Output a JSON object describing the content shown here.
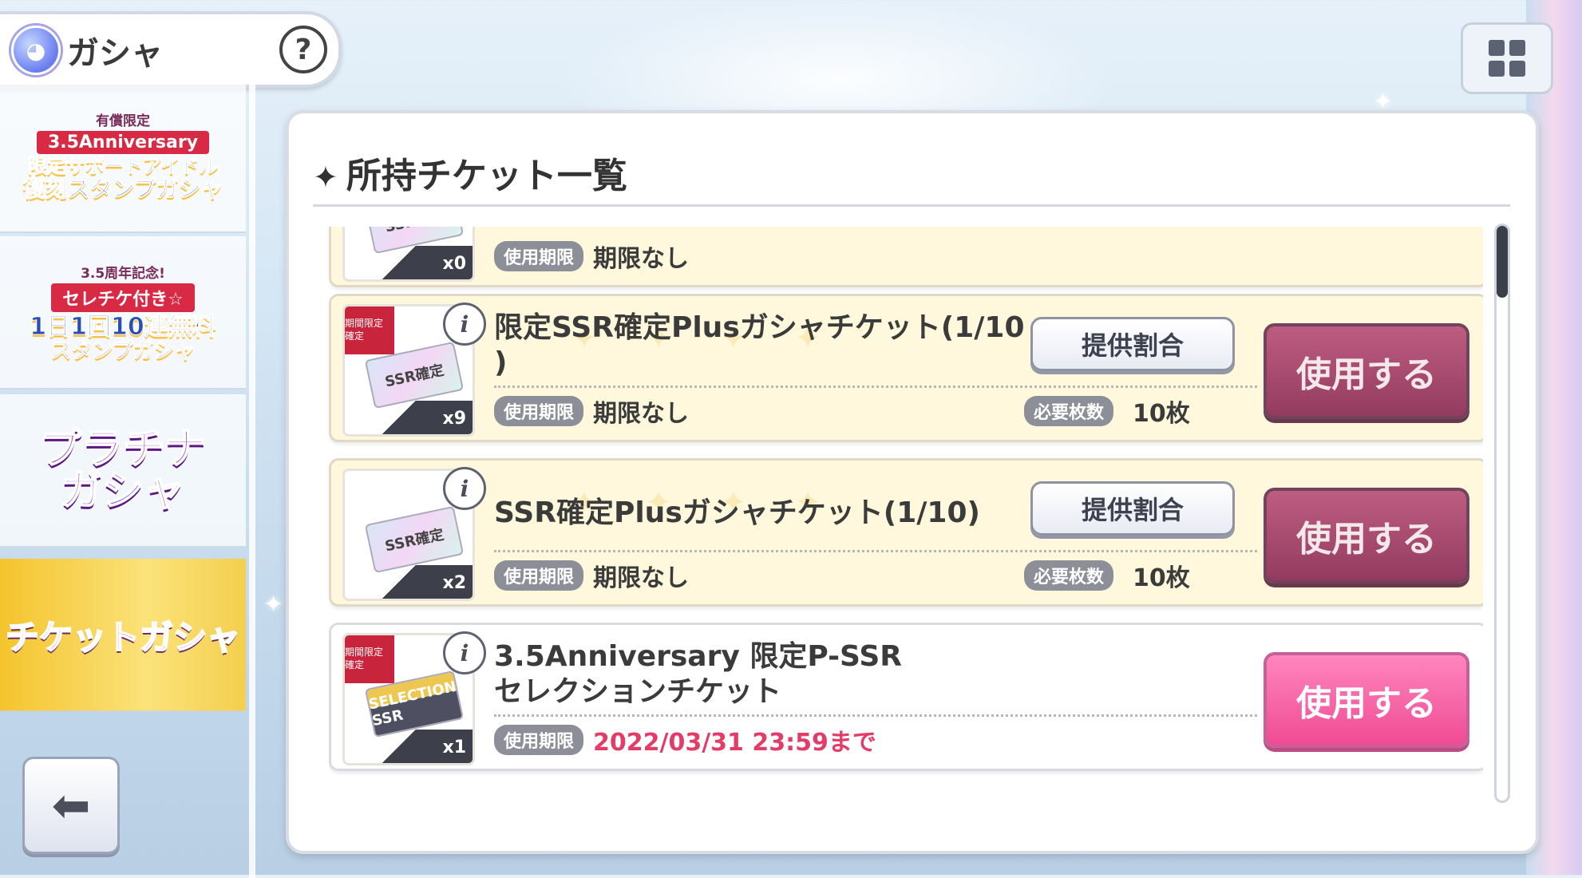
{
  "header": {
    "title": "ガシャ",
    "help": "?"
  },
  "menu_icon": "grid-menu-icon",
  "sidebar": {
    "items": [
      {
        "small": "有償限定",
        "ribbon": "3.5Anniversary",
        "line1": "限定サポートアイドル",
        "line2": "復刻スタンプガシャ"
      },
      {
        "small": "3.5周年記念!",
        "ribbon": "セレチケ付き☆",
        "line1": "1日1回10連無料",
        "line2": "スタンプガシャ"
      },
      {
        "line1": "プラチナ",
        "line2": "ガシャ"
      },
      {
        "line1": "チケットガシャ"
      }
    ],
    "back_icon": "back-arrow-icon"
  },
  "panel": {
    "title": "所持チケット一覧",
    "labels": {
      "expiry": "使用期限",
      "required": "必要枚数",
      "rate": "提供割合",
      "use": "使用する"
    },
    "tickets": [
      {
        "art": "SSR確定",
        "count": "x0",
        "expiry": "期限なし",
        "name": "",
        "required": ""
      },
      {
        "art": "SSR確定",
        "tag": "期間限定 確定",
        "count": "x9",
        "name_line1": "限定SSR確定Plusガシャチケット(1/10",
        "name_line2": ")",
        "expiry": "期限なし",
        "required": "10枚"
      },
      {
        "art": "SSR確定",
        "count": "x2",
        "name_line1": "SSR確定Plusガシャチケット(1/10)",
        "expiry": "期限なし",
        "required": "10枚"
      },
      {
        "art": "SELECTION SSR",
        "tag": "期間限定 確定",
        "count": "x1",
        "name_line1": "3.5Anniversary 限定P-SSR",
        "name_line2": "セレクションチケット",
        "expiry": "2022/03/31 23:59まで"
      }
    ]
  }
}
